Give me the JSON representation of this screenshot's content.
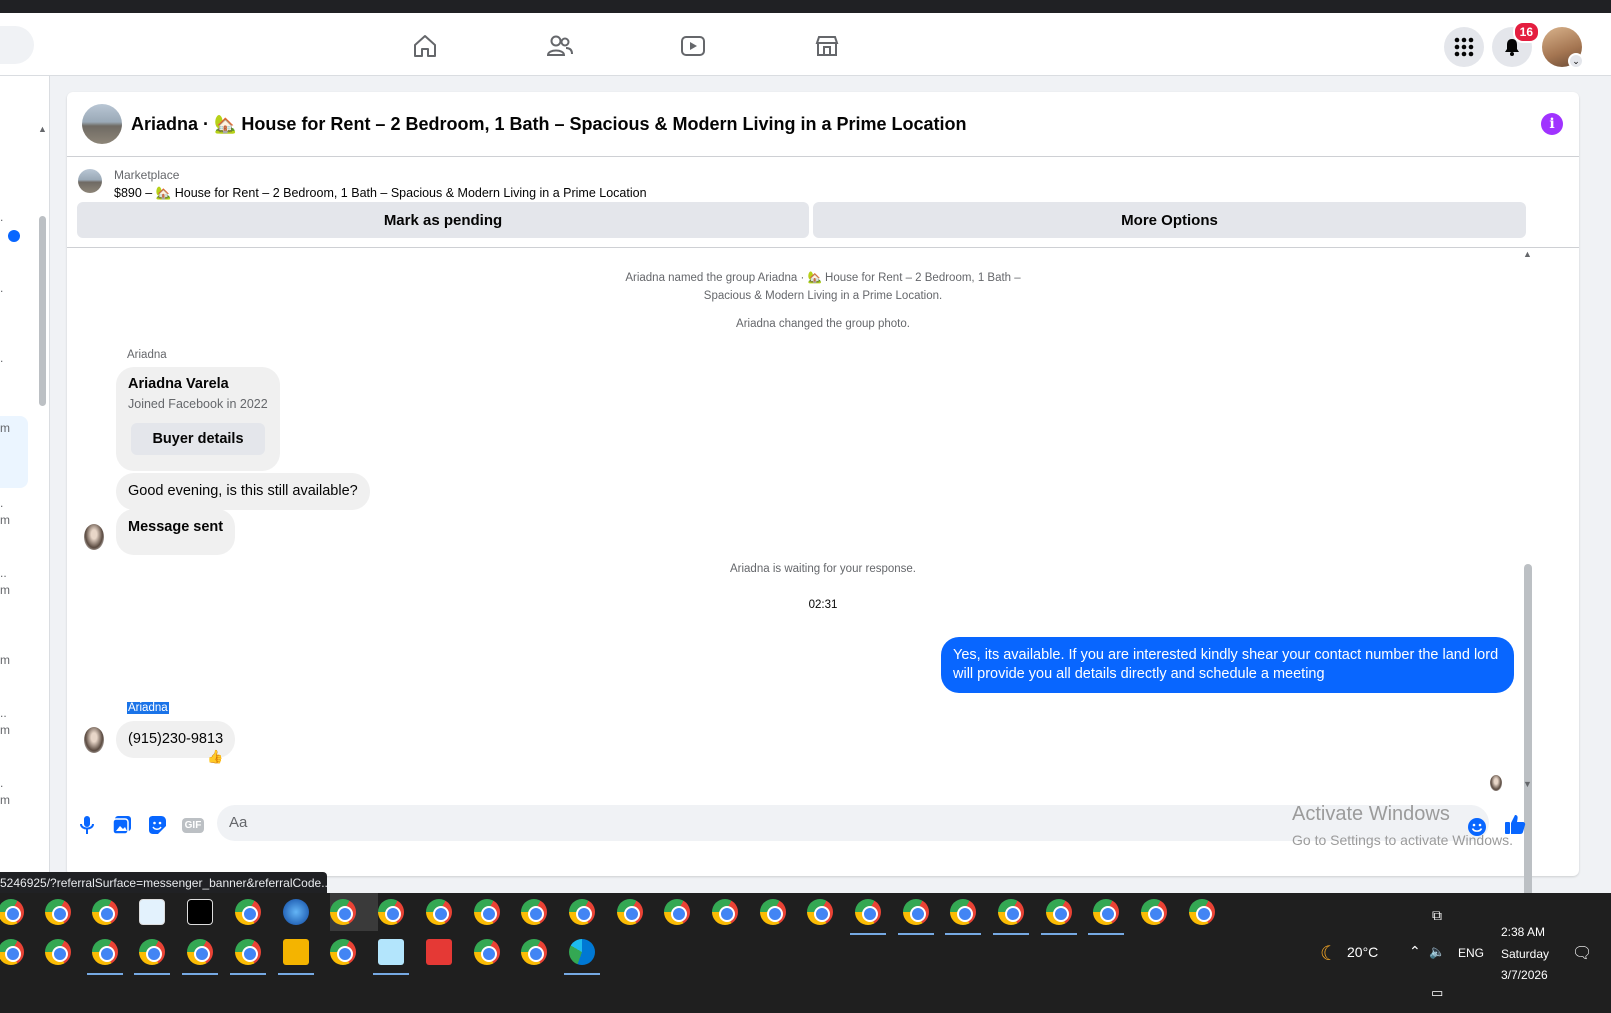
{
  "topbar": {
    "notification_count": "16",
    "nav_icons": [
      "home-icon",
      "friends-icon",
      "video-icon",
      "marketplace-icon"
    ]
  },
  "chat": {
    "title": "Ariadna · 🏡 House for Rent – 2 Bedroom, 1 Bath – Spacious & Modern Living in a Prime Location",
    "marketplace": {
      "label": "Marketplace",
      "item": "$890 – 🏡 House for Rent – 2 Bedroom, 1 Bath – Spacious & Modern Living in a Prime Location",
      "mark_pending": "Mark as pending",
      "more_options": "More Options"
    },
    "messages": {
      "sys_named_1": "Ariadna named the group Ariadna · 🏡 House for Rent – 2 Bedroom, 1 Bath –",
      "sys_named_2": "Spacious & Modern Living in a Prime Location.",
      "sys_photo": "Ariadna changed the group photo.",
      "sender_1": "Ariadna",
      "profile_name": "Ariadna Varela",
      "profile_joined": "Joined Facebook in 2022",
      "buyer_details": "Buyer details",
      "msg_1": "Good evening, is this still available?",
      "msg_2": "Message sent",
      "sys_waiting": "Ariadna is waiting for your response.",
      "time": "02:31",
      "msg_out": "Yes, its available. If you are interested kindly shear your contact number the land lord will provide you all details directly and schedule a meeting",
      "sender_2": "Ariadna",
      "msg_3": "(915)230-9813",
      "reaction": "👍"
    },
    "composer": {
      "placeholder": "Aa",
      "gif": "GIF"
    }
  },
  "watermark": {
    "line1": "Activate Windows",
    "line2": "Go to Settings to activate Windows."
  },
  "statusbar": {
    "url": "5246925/?referralSurface=messenger_banner&referralCode..."
  },
  "tray": {
    "weather": "20°C",
    "lang": "ENG",
    "time": "2:38 AM",
    "day": "Saturday",
    "date": "3/7/2026"
  },
  "left_fragments": [
    ".",
    ".",
    ".",
    "m",
    ".",
    "m",
    "..",
    "m",
    "m",
    "..",
    "m",
    ".",
    "m"
  ]
}
